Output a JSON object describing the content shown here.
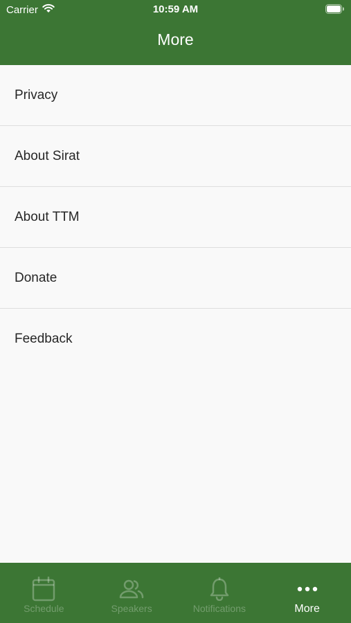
{
  "status_bar": {
    "carrier": "Carrier",
    "time": "10:59 AM",
    "wifi_icon": "wifi-icon",
    "battery_icon": "battery-icon"
  },
  "header": {
    "title": "More",
    "background_color": "#3c7634"
  },
  "menu": {
    "items": [
      {
        "label": "Privacy"
      },
      {
        "label": "About Sirat"
      },
      {
        "label": "About TTM"
      },
      {
        "label": "Donate"
      },
      {
        "label": "Feedback"
      }
    ]
  },
  "tab_bar": {
    "active_tab": "More",
    "tabs": [
      {
        "label": "Schedule",
        "icon": "calendar-icon"
      },
      {
        "label": "Speakers",
        "icon": "people-icon"
      },
      {
        "label": "Notifications",
        "icon": "bell-icon"
      },
      {
        "label": "More",
        "icon": "more-dots-icon"
      }
    ]
  }
}
